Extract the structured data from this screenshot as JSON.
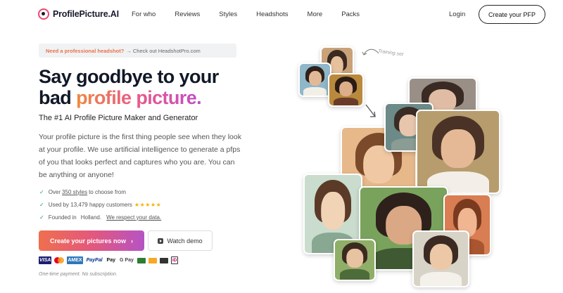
{
  "brand": {
    "name": "ProfilePicture.AI"
  },
  "nav": {
    "links": [
      "For who",
      "Reviews",
      "Styles",
      "Headshots",
      "More",
      "Packs"
    ],
    "login": "Login",
    "cta": "Create your PFP"
  },
  "announcement": {
    "highlight": "Need a professional headshot?",
    "text": "→ Check out HeadshotPro.com"
  },
  "hero": {
    "title_line1": "Say goodbye to your",
    "title_line2_prefix": "bad ",
    "title_line2_highlight": "profile picture.",
    "subtitle": "The #1 AI Profile Picture Maker and Generator",
    "description": "Your profile picture is the first thing people see when they look at your profile. We use artificial intelligence to generate a pfps of you that looks perfect and captures who you are. You can be anything or anyone!"
  },
  "features": {
    "item1_prefix": "Over",
    "item1_link": "350 styles",
    "item1_suffix": "to choose from",
    "item2": "Used by 13,479 happy customers",
    "item2_stars": "★★★★★",
    "item3_prefix": "Founded in",
    "item3_country": "Holland.",
    "item3_link": "We respect your data."
  },
  "buttons": {
    "primary": "Create your pictures now",
    "primary_arrow": "›",
    "secondary": "Watch demo"
  },
  "payments": {
    "visa": "VISA",
    "amex": "AMEX",
    "paypal": "PayPal",
    "apple": " Pay",
    "gpay": "G Pay",
    "ideal": "iD"
  },
  "footnote": "One-time payment. No subscription.",
  "collage": {
    "training_label": "Training set"
  },
  "colors": {
    "accent_start": "#f0883e",
    "accent_mid": "#e85a8a",
    "accent_end": "#c04dc8",
    "check": "#22a06b",
    "star": "#f5b301"
  }
}
